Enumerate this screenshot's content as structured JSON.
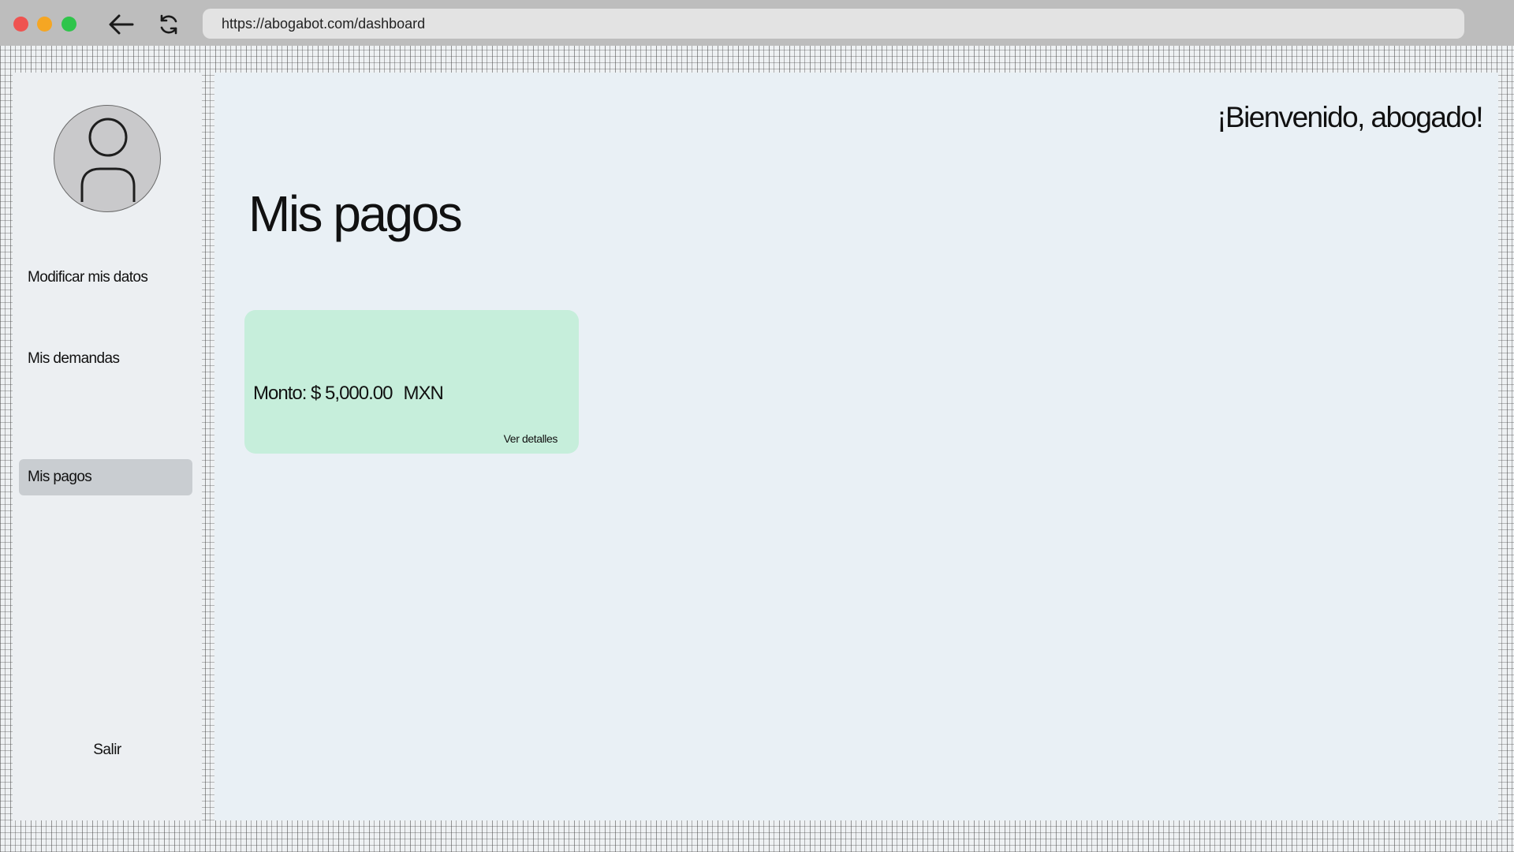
{
  "browser": {
    "url": "https://abogabot.com/dashboard",
    "traffic_lights": {
      "close": "#ef5350",
      "minimize": "#f5a623",
      "maximize": "#2fc54b"
    }
  },
  "sidebar": {
    "items": [
      {
        "label": "Modificar mis datos",
        "active": false
      },
      {
        "label": "Mis demandas",
        "active": false
      },
      {
        "label": "Mis pagos",
        "active": true
      }
    ],
    "logout_label": "Salir"
  },
  "header": {
    "welcome": "¡Bienvenido, abogado!"
  },
  "main": {
    "title": "Mis pagos",
    "payments": [
      {
        "amount_label": "Monto: $ 5,000.00",
        "currency": "MXN",
        "details_label": "Ver detalles"
      }
    ]
  },
  "colors": {
    "card_background": "#c6eedb",
    "active_item": "#c9cdd1",
    "main_background": "#e9f0f5"
  }
}
